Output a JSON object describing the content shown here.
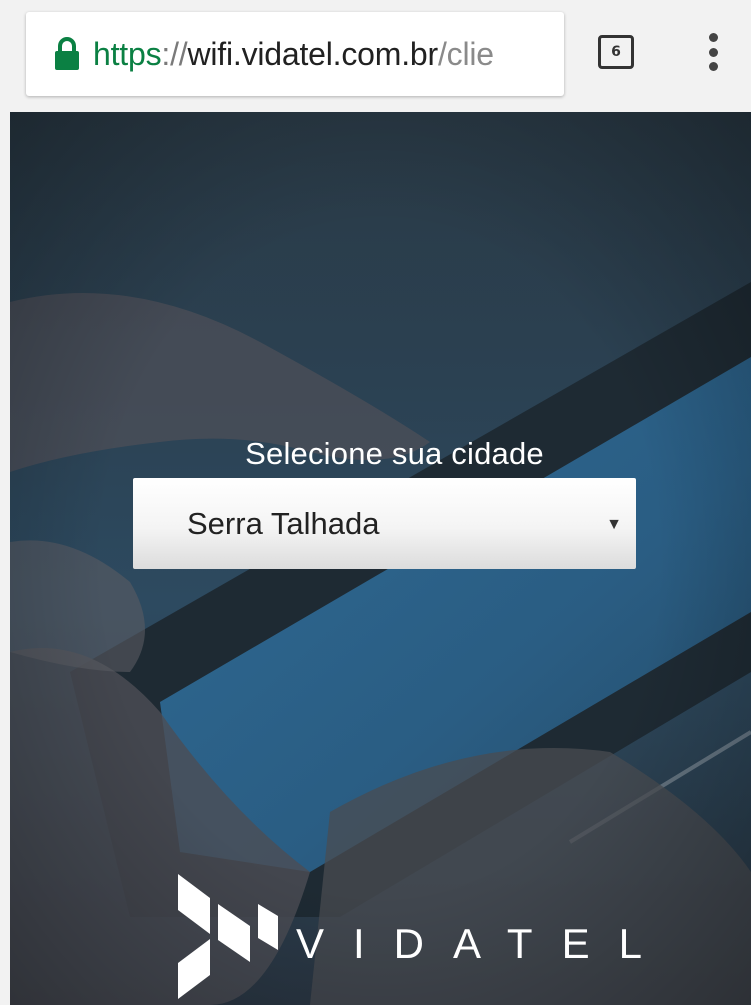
{
  "browser": {
    "url_scheme": "https",
    "url_separator": "://",
    "url_host": "wifi.vidatel.com.br",
    "url_path": "/clie",
    "tab_count": "6",
    "colors": {
      "scheme": "#0b8043",
      "lock": "#0b8043"
    },
    "icons": {
      "lock": "lock-icon",
      "tabs": "tab-switcher-icon",
      "menu": "overflow-menu-icon"
    }
  },
  "page": {
    "title": "Selecione sua cidade",
    "city_select": {
      "selected_value": "Serra Talhada"
    },
    "logo_text": "VIDATEL"
  }
}
